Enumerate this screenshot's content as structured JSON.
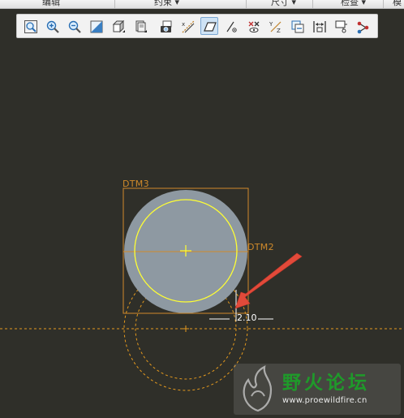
{
  "menu": {
    "items": [
      {
        "label": "编辑"
      },
      {
        "label": "约束 ▾"
      },
      {
        "label": "尺寸 ▾"
      },
      {
        "label": "检查 ▾"
      },
      {
        "label": "模"
      }
    ]
  },
  "toolbar": {
    "buttons": [
      {
        "icon": "zoom-fit-icon"
      },
      {
        "icon": "zoom-in-icon"
      },
      {
        "icon": "zoom-out-icon"
      },
      {
        "icon": "view-orient-icon"
      },
      {
        "icon": "view-style-icon"
      },
      {
        "icon": "saved-views-icon"
      },
      {
        "icon": "camera-icon"
      },
      {
        "icon": "datum-display-icon"
      },
      {
        "icon": "sketch-plane-icon",
        "active": true
      },
      {
        "icon": "dim-display-icon"
      },
      {
        "icon": "constraint-display-icon"
      },
      {
        "icon": "vertex-display-icon"
      },
      {
        "icon": "sketch-view-icon"
      },
      {
        "icon": "dim-lock-icon"
      },
      {
        "icon": "snap-display-icon"
      },
      {
        "icon": "spin-center-icon"
      }
    ]
  },
  "canvas": {
    "datum_labels": {
      "dtm3": "DTM3",
      "dtm2": "DTM2"
    },
    "dimension": {
      "value": "2.10"
    },
    "colors": {
      "background": "#2f2f29",
      "datum": "#d08a2a",
      "fill": "#8e99a2",
      "sketch": "#ffff33",
      "dashed": "#e59a1e",
      "arrow": "#e24a3a"
    }
  },
  "watermark": {
    "title": "野火论坛",
    "url": "www.proewildfire.cn"
  }
}
